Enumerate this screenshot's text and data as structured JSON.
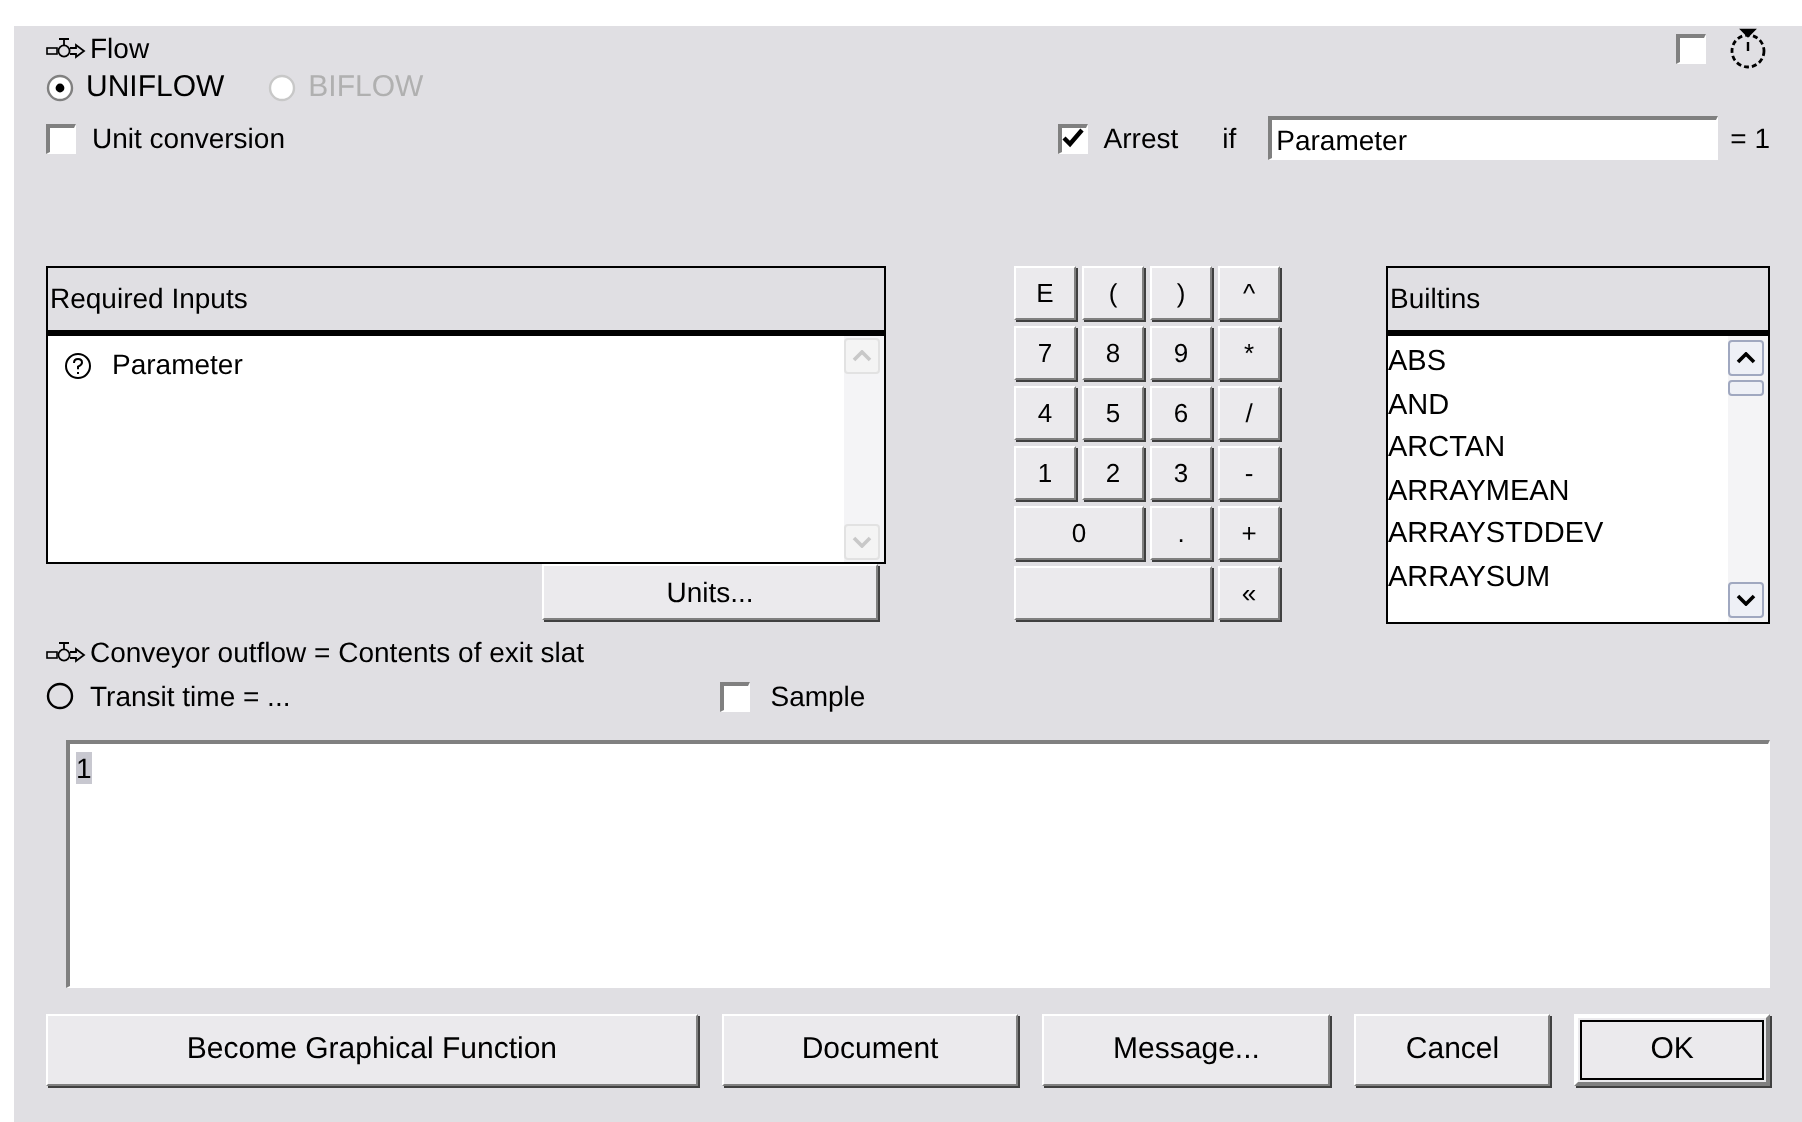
{
  "flow": {
    "title": "Flow",
    "timer_checked": false
  },
  "flow_types": [
    {
      "label": "UNIFLOW",
      "selected": true,
      "disabled": false
    },
    {
      "label": "BIFLOW",
      "selected": false,
      "disabled": true
    }
  ],
  "unit_conversion": {
    "label": "Unit conversion",
    "checked": false
  },
  "arrest": {
    "label": "Arrest",
    "checked": true,
    "if_label": "if",
    "value": "Parameter",
    "suffix": "= 1"
  },
  "required_inputs": {
    "header": "Required Inputs",
    "items": [
      "Parameter"
    ],
    "units_button": "Units..."
  },
  "keypad": [
    {
      "label": "E",
      "kind": "key"
    },
    {
      "label": "(",
      "kind": "key"
    },
    {
      "label": ")",
      "kind": "key"
    },
    {
      "label": "^",
      "kind": "key"
    },
    {
      "label": "7",
      "kind": "key"
    },
    {
      "label": "8",
      "kind": "key"
    },
    {
      "label": "9",
      "kind": "key"
    },
    {
      "label": "*",
      "kind": "key"
    },
    {
      "label": "4",
      "kind": "key"
    },
    {
      "label": "5",
      "kind": "key"
    },
    {
      "label": "6",
      "kind": "key"
    },
    {
      "label": "/",
      "kind": "key"
    },
    {
      "label": "1",
      "kind": "key"
    },
    {
      "label": "2",
      "kind": "key"
    },
    {
      "label": "3",
      "kind": "key"
    },
    {
      "label": "-",
      "kind": "key"
    },
    {
      "label": "0",
      "kind": "wide"
    },
    {
      "label": ".",
      "kind": "key"
    },
    {
      "label": "+",
      "kind": "key"
    },
    {
      "kind": "wider"
    },
    {
      "label": "«",
      "kind": "key"
    }
  ],
  "builtins": {
    "header": "Builtins",
    "items": [
      "ABS",
      "AND",
      "ARCTAN",
      "ARRAYMEAN",
      "ARRAYSTDDEV",
      "ARRAYSUM"
    ]
  },
  "conveyor": {
    "text": "Conveyor outflow = Contents of exit slat"
  },
  "transit": {
    "label": "Transit time = ...",
    "selected": false
  },
  "sample": {
    "label": "Sample",
    "checked": false
  },
  "expression": {
    "value": "1",
    "selected": true
  },
  "buttons": [
    {
      "label": "Become Graphical Function",
      "default": false
    },
    {
      "label": "Document",
      "default": false
    },
    {
      "label": "Message...",
      "default": false
    },
    {
      "label": "Cancel",
      "default": false
    },
    {
      "label": "OK",
      "default": true
    }
  ]
}
